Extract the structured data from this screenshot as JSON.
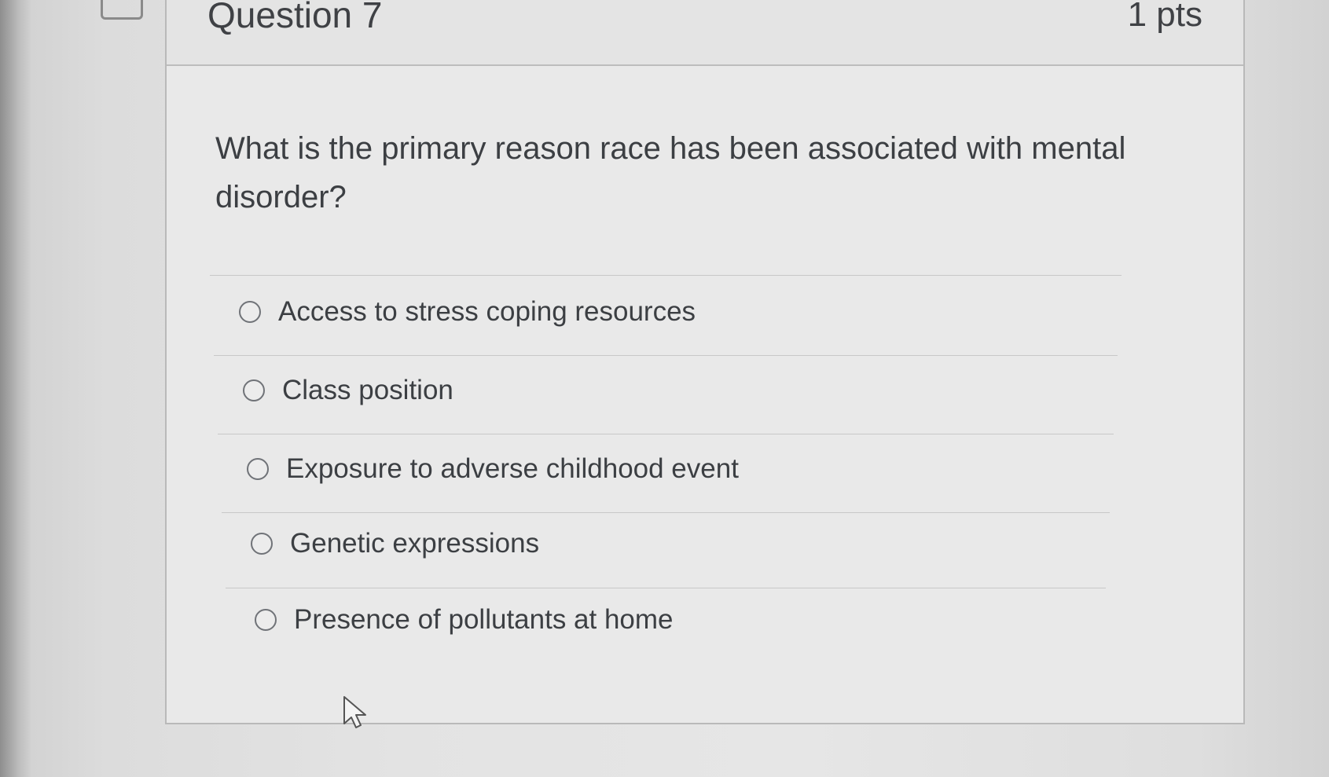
{
  "question": {
    "title": "Question 7",
    "points": "1 pts",
    "text": "What is the primary reason race has been associated with mental disorder?"
  },
  "answers": [
    {
      "label": "Access to stress coping resources",
      "selected": false
    },
    {
      "label": "Class position",
      "selected": false
    },
    {
      "label": "Exposure to adverse childhood event",
      "selected": false
    },
    {
      "label": "Genetic expressions",
      "selected": false
    },
    {
      "label": "Presence of pollutants at home",
      "selected": false
    }
  ],
  "icons": {
    "bookmark": "bookmark-icon",
    "radio": "radio-icon",
    "cursor": "mouse-pointer-icon"
  },
  "colors": {
    "text": "#3c3f43",
    "border": "#b9b9b9",
    "background": "#e6e6e6"
  }
}
